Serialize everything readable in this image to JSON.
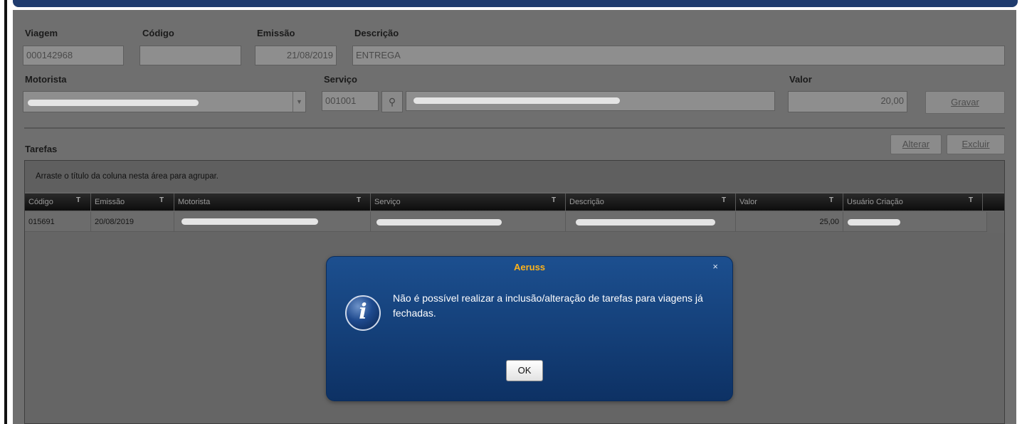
{
  "form": {
    "viagem_label": "Viagem",
    "viagem_value": "000142968",
    "codigo_label": "Código",
    "codigo_value": "",
    "emissao_label": "Emissão",
    "emissao_value": "21/08/2019",
    "descricao_label": "Descrição",
    "descricao_value": "ENTREGA",
    "motorista_label": "Motorista",
    "servico_label": "Serviço",
    "servico_code": "001001",
    "valor_label": "Valor",
    "valor_value": "20,00",
    "gravar_button": "Gravar"
  },
  "tarefas": {
    "title": "Tarefas",
    "alterar_button": "Alterar",
    "excluir_button": "Excluir",
    "group_hint": "Arraste o título da coluna nesta área para agrupar.",
    "columns": [
      "Código",
      "Emissão",
      "Motorista",
      "Serviço",
      "Descrição",
      "Valor",
      "Usuário Criação"
    ],
    "rows": [
      {
        "codigo": "015691",
        "emissao": "20/08/2019",
        "valor": "25,00"
      }
    ]
  },
  "dialog": {
    "title": "Aeruss",
    "close_glyph": "×",
    "message": "Não é possível realizar a inclusão/alteração de tarefas para viagens já fechadas.",
    "ok_button": "OK",
    "icon": "info-icon"
  },
  "colors": {
    "dialog_bg": "#143f78",
    "dialog_title": "#ffb31a",
    "top_bar": "#1f3b6e"
  }
}
